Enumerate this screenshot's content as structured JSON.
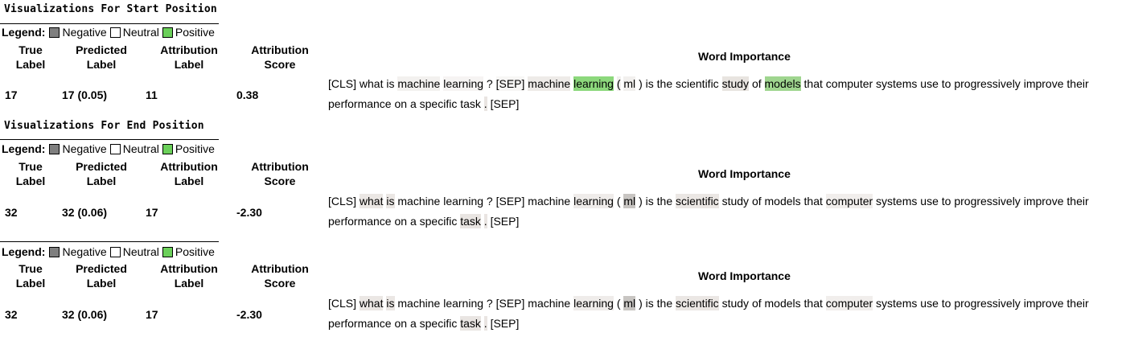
{
  "legend": {
    "label": "Legend:",
    "items": [
      {
        "label": "Negative",
        "color": "#7f7f7f"
      },
      {
        "label": "Neutral",
        "color": "#ffffff"
      },
      {
        "label": "Positive",
        "color": "#6bd05a"
      }
    ]
  },
  "headers": {
    "true_label": [
      "True",
      "Label"
    ],
    "predicted_label": [
      "Predicted",
      "Label"
    ],
    "attribution_label": [
      "Attribution",
      "Label"
    ],
    "attribution_score": [
      "Attribution",
      "Score"
    ]
  },
  "word_importance_title": "Word Importance",
  "sections": [
    {
      "title": "Visualizations For Start Position",
      "true_label": "17",
      "predicted_label": "17 (0.05)",
      "attribution_label": "11",
      "attribution_score": "0.38",
      "tokens": [
        {
          "t": "[CLS]",
          "bg": "#ffffff"
        },
        {
          "t": "what",
          "bg": "#ffffff"
        },
        {
          "t": "is",
          "bg": "#ffffff"
        },
        {
          "t": "machine",
          "bg": "#f3f1ef"
        },
        {
          "t": "learning",
          "bg": "#f6f4f3"
        },
        {
          "t": "?",
          "bg": "#ffffff"
        },
        {
          "t": "[SEP]",
          "bg": "#f7f6f5"
        },
        {
          "t": "machine",
          "bg": "#eeebe8"
        },
        {
          "t": "learning",
          "bg": "#8cd87c"
        },
        {
          "t": "(",
          "bg": "#f1efed"
        },
        {
          "t": "ml",
          "bg": "#f2f0ee"
        },
        {
          "t": ")",
          "bg": "#ffffff"
        },
        {
          "t": "is",
          "bg": "#ffffff"
        },
        {
          "t": "the",
          "bg": "#ffffff"
        },
        {
          "t": "scientific",
          "bg": "#ffffff"
        },
        {
          "t": "study",
          "bg": "#e8e4e0"
        },
        {
          "t": "of",
          "bg": "#ffffff"
        },
        {
          "t": "models",
          "bg": "#9fd58f"
        },
        {
          "t": "that",
          "bg": "#ffffff"
        },
        {
          "t": "computer",
          "bg": "#ffffff"
        },
        {
          "t": "systems",
          "bg": "#ffffff"
        },
        {
          "t": "use",
          "bg": "#ffffff"
        },
        {
          "t": "to",
          "bg": "#ffffff"
        },
        {
          "t": "progressively",
          "bg": "#ffffff"
        },
        {
          "t": "improve",
          "bg": "#ffffff"
        },
        {
          "t": "their",
          "bg": "#ffffff"
        },
        {
          "t": "performance",
          "bg": "#ffffff"
        },
        {
          "t": "on",
          "bg": "#ffffff"
        },
        {
          "t": "a",
          "bg": "#ffffff"
        },
        {
          "t": "specific",
          "bg": "#ffffff"
        },
        {
          "t": "task",
          "bg": "#ffffff"
        },
        {
          "t": ".",
          "bg": "#e9e5e2"
        },
        {
          "t": "[SEP]",
          "bg": "#ffffff"
        }
      ]
    },
    {
      "title": "Visualizations For End Position",
      "true_label": "32",
      "predicted_label": "32 (0.06)",
      "attribution_label": "17",
      "attribution_score": "-2.30",
      "tokens": [
        {
          "t": "[CLS]",
          "bg": "#ffffff"
        },
        {
          "t": "what",
          "bg": "#ebe7e4"
        },
        {
          "t": "is",
          "bg": "#ebe7e4"
        },
        {
          "t": "machine",
          "bg": "#ffffff"
        },
        {
          "t": "learning",
          "bg": "#ffffff"
        },
        {
          "t": "?",
          "bg": "#ffffff"
        },
        {
          "t": "[SEP]",
          "bg": "#ffffff"
        },
        {
          "t": "machine",
          "bg": "#ffffff"
        },
        {
          "t": "learning",
          "bg": "#efecea"
        },
        {
          "t": "(",
          "bg": "#ffffff"
        },
        {
          "t": "ml",
          "bg": "#c8c5c2"
        },
        {
          "t": ")",
          "bg": "#ffffff"
        },
        {
          "t": "is",
          "bg": "#ffffff"
        },
        {
          "t": "the",
          "bg": "#ffffff"
        },
        {
          "t": "scientific",
          "bg": "#ebe7e4"
        },
        {
          "t": "study",
          "bg": "#ffffff"
        },
        {
          "t": "of",
          "bg": "#ffffff"
        },
        {
          "t": "models",
          "bg": "#ffffff"
        },
        {
          "t": "that",
          "bg": "#ffffff"
        },
        {
          "t": "computer",
          "bg": "#f1eeec"
        },
        {
          "t": "systems",
          "bg": "#ffffff"
        },
        {
          "t": "use",
          "bg": "#ffffff"
        },
        {
          "t": "to",
          "bg": "#ffffff"
        },
        {
          "t": "progressively",
          "bg": "#ffffff"
        },
        {
          "t": "improve",
          "bg": "#ffffff"
        },
        {
          "t": "their",
          "bg": "#ffffff"
        },
        {
          "t": "performance",
          "bg": "#ffffff"
        },
        {
          "t": "on",
          "bg": "#ffffff"
        },
        {
          "t": "a",
          "bg": "#ffffff"
        },
        {
          "t": "specific",
          "bg": "#ffffff"
        },
        {
          "t": "task",
          "bg": "#e9e5e2"
        },
        {
          "t": ".",
          "bg": "#e9e5e2"
        },
        {
          "t": "[SEP]",
          "bg": "#ffffff"
        }
      ]
    },
    {
      "title": "",
      "true_label": "32",
      "predicted_label": "32 (0.06)",
      "attribution_label": "17",
      "attribution_score": "-2.30",
      "tokens": [
        {
          "t": "[CLS]",
          "bg": "#ffffff"
        },
        {
          "t": "what",
          "bg": "#ebe7e4"
        },
        {
          "t": "is",
          "bg": "#ebe7e4"
        },
        {
          "t": "machine",
          "bg": "#ffffff"
        },
        {
          "t": "learning",
          "bg": "#ffffff"
        },
        {
          "t": "?",
          "bg": "#ffffff"
        },
        {
          "t": "[SEP]",
          "bg": "#ffffff"
        },
        {
          "t": "machine",
          "bg": "#ffffff"
        },
        {
          "t": "learning",
          "bg": "#efecea"
        },
        {
          "t": "(",
          "bg": "#ffffff"
        },
        {
          "t": "ml",
          "bg": "#c8c5c2"
        },
        {
          "t": ")",
          "bg": "#ffffff"
        },
        {
          "t": "is",
          "bg": "#ffffff"
        },
        {
          "t": "the",
          "bg": "#ffffff"
        },
        {
          "t": "scientific",
          "bg": "#ebe7e4"
        },
        {
          "t": "study",
          "bg": "#ffffff"
        },
        {
          "t": "of",
          "bg": "#ffffff"
        },
        {
          "t": "models",
          "bg": "#ffffff"
        },
        {
          "t": "that",
          "bg": "#ffffff"
        },
        {
          "t": "computer",
          "bg": "#f1eeec"
        },
        {
          "t": "systems",
          "bg": "#ffffff"
        },
        {
          "t": "use",
          "bg": "#ffffff"
        },
        {
          "t": "to",
          "bg": "#ffffff"
        },
        {
          "t": "progressively",
          "bg": "#ffffff"
        },
        {
          "t": "improve",
          "bg": "#ffffff"
        },
        {
          "t": "their",
          "bg": "#ffffff"
        },
        {
          "t": "performance",
          "bg": "#ffffff"
        },
        {
          "t": "on",
          "bg": "#ffffff"
        },
        {
          "t": "a",
          "bg": "#ffffff"
        },
        {
          "t": "specific",
          "bg": "#ffffff"
        },
        {
          "t": "task",
          "bg": "#e9e5e2"
        },
        {
          "t": ".",
          "bg": "#e9e5e2"
        },
        {
          "t": "[SEP]",
          "bg": "#ffffff"
        }
      ]
    }
  ]
}
